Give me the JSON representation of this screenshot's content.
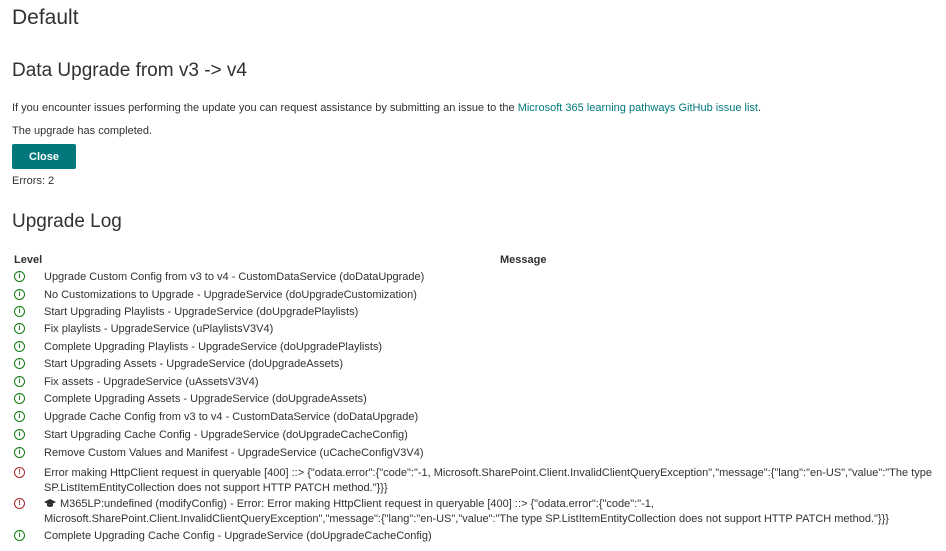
{
  "page": {
    "title": "Default"
  },
  "upgrade": {
    "heading": "Data Upgrade from v3 -> v4",
    "intro_text": "If you encounter issues performing the update you can request assistance by submitting an issue to the ",
    "intro_link": "Microsoft 365 learning pathways GitHub issue list",
    "intro_end": ".",
    "status": "The upgrade has completed.",
    "close_label": "Close",
    "errors": "Errors: 2"
  },
  "log": {
    "heading": "Upgrade Log",
    "col_level": "Level",
    "col_message": "Message",
    "rows": [
      {
        "level": "info",
        "icon": "info-circle-icon",
        "message": "Upgrade Custom Config from v3 to v4 - CustomDataService (doDataUpgrade)"
      },
      {
        "level": "info",
        "icon": "info-circle-icon",
        "message": "No Customizations to Upgrade - UpgradeService (doUpgradeCustomization)"
      },
      {
        "level": "info",
        "icon": "info-circle-icon",
        "message": "Start Upgrading Playlists - UpgradeService (doUpgradePlaylists)"
      },
      {
        "level": "info",
        "icon": "info-circle-icon",
        "message": "Fix playlists - UpgradeService (uPlaylistsV3V4)"
      },
      {
        "level": "info",
        "icon": "info-circle-icon",
        "message": "Complete Upgrading Playlists - UpgradeService (doUpgradePlaylists)"
      },
      {
        "level": "info",
        "icon": "info-circle-icon",
        "message": "Start Upgrading Assets - UpgradeService (doUpgradeAssets)"
      },
      {
        "level": "info",
        "icon": "info-circle-icon",
        "message": "Fix assets - UpgradeService (uAssetsV3V4)"
      },
      {
        "level": "info",
        "icon": "info-circle-icon",
        "message": "Complete Upgrading Assets - UpgradeService (doUpgradeAssets)"
      },
      {
        "level": "info",
        "icon": "info-circle-icon",
        "message": "Upgrade Cache Config from v3 to v4 - CustomDataService (doDataUpgrade)"
      },
      {
        "level": "info",
        "icon": "info-circle-icon",
        "message": "Start Upgrading Cache Config - UpgradeService (doUpgradeCacheConfig)"
      },
      {
        "level": "info",
        "icon": "info-circle-icon",
        "message": "Remove Custom Values and Manifest - UpgradeService (uCacheConfigV3V4)"
      },
      {
        "level": "error",
        "icon": "error-circle-icon",
        "message": "Error making HttpClient request in queryable [400] ::> {\"odata.error\":{\"code\":\"-1, Microsoft.SharePoint.Client.InvalidClientQueryException\",\"message\":{\"lang\":\"en-US\",\"value\":\"The type SP.ListItemEntityCollection does not support HTTP PATCH method.\"}}}"
      },
      {
        "level": "error",
        "icon": "error-circle-icon",
        "message": "M365LP:undefined (modifyConfig) - Error: Error making HttpClient request in queryable [400] ::> {\"odata.error\":{\"code\":\"-1, Microsoft.SharePoint.Client.InvalidClientQueryException\",\"message\":{\"lang\":\"en-US\",\"value\":\"The type SP.ListItemEntityCollection does not support HTTP PATCH method.\"}}}"
      },
      {
        "level": "info",
        "icon": "info-circle-icon",
        "message": "Complete Upgrading Cache Config - UpgradeService (doUpgradeCacheConfig)"
      }
    ]
  },
  "colors": {
    "accent": "#03787c",
    "info": "#107c10",
    "error": "#a4262c",
    "text": "#323130"
  }
}
